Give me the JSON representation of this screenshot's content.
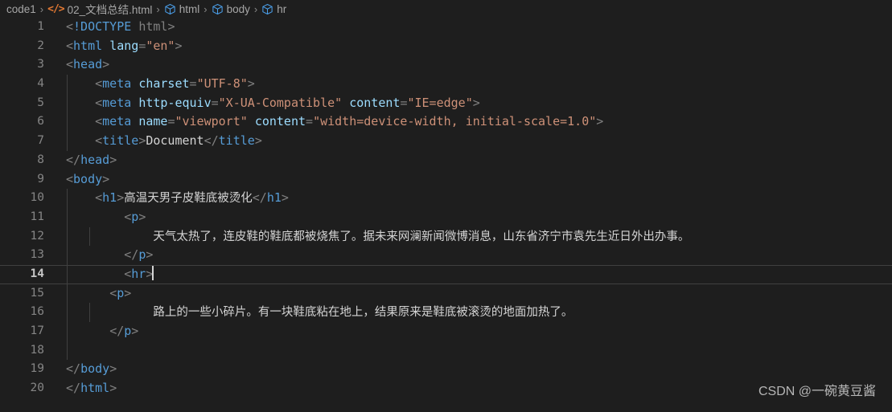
{
  "breadcrumb": {
    "items": [
      {
        "label": "code1",
        "icon": "none"
      },
      {
        "label": "02_文档总结.html",
        "icon": "code-icon"
      },
      {
        "label": "html",
        "icon": "symbol-cube-icon"
      },
      {
        "label": "body",
        "icon": "symbol-cube-icon"
      },
      {
        "label": "hr",
        "icon": "symbol-cube-icon"
      }
    ],
    "separator": "›"
  },
  "editor": {
    "active_line": 14,
    "colors": {
      "background": "#1e1e1e",
      "tag": "#569cd6",
      "attribute": "#9cdcfe",
      "string": "#ce9178",
      "text": "#d4d4d4",
      "bracket": "#808080",
      "line_number": "#858585",
      "indent_guide": "#404040"
    },
    "lines": [
      {
        "n": "1",
        "text": "<!DOCTYPE html>"
      },
      {
        "n": "2",
        "text": "<html lang=\"en\">"
      },
      {
        "n": "3",
        "text": "<head>"
      },
      {
        "n": "4",
        "text": "    <meta charset=\"UTF-8\">"
      },
      {
        "n": "5",
        "text": "    <meta http-equiv=\"X-UA-Compatible\" content=\"IE=edge\">"
      },
      {
        "n": "6",
        "text": "    <meta name=\"viewport\" content=\"width=device-width, initial-scale=1.0\">"
      },
      {
        "n": "7",
        "text": "    <title>Document</title>"
      },
      {
        "n": "8",
        "text": "</head>"
      },
      {
        "n": "9",
        "text": "<body>"
      },
      {
        "n": "10",
        "text": "    <h1>高温天男子皮鞋底被烫化</h1>"
      },
      {
        "n": "11",
        "text": "        <p>"
      },
      {
        "n": "12",
        "text": "            天气太热了，连皮鞋的鞋底都被烧焦了。据未来网澜新闻微博消息，山东省济宁市袁先生近日外出办事。"
      },
      {
        "n": "13",
        "text": "        </p>"
      },
      {
        "n": "14",
        "text": "        <hr>"
      },
      {
        "n": "15",
        "text": "      <p>"
      },
      {
        "n": "16",
        "text": "            路上的一些小碎片。有一块鞋底粘在地上，结果原来是鞋底被滚烫的地面加热了。"
      },
      {
        "n": "17",
        "text": "      </p>"
      },
      {
        "n": "18",
        "text": ""
      },
      {
        "n": "19",
        "text": "</body>"
      },
      {
        "n": "20",
        "text": "</html>"
      }
    ]
  },
  "watermark": {
    "text": "CSDN @一碗黄豆酱"
  }
}
